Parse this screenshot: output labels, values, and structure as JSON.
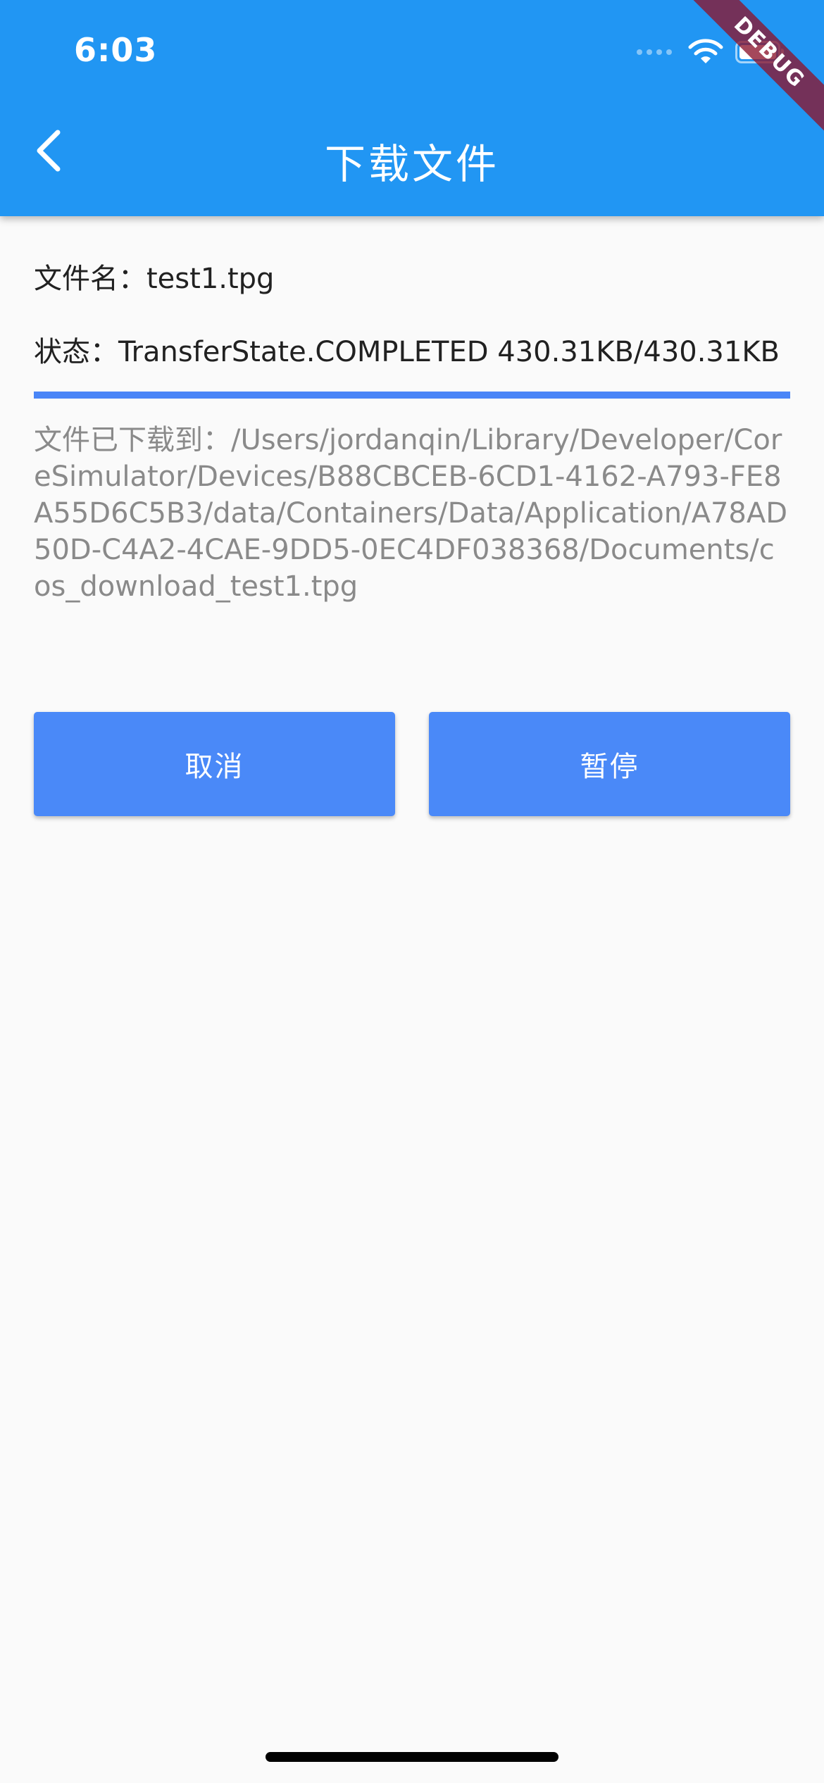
{
  "status_bar": {
    "time": "6:03"
  },
  "app_bar": {
    "title": "下载文件",
    "back_icon": "chevron-left-icon",
    "color": "#2196F3"
  },
  "debug_banner": {
    "label": "DEBUG"
  },
  "content": {
    "file_name_text": "文件名：test1.tpg",
    "status_text": "状态：TransferState.COMPLETED  430.31KB/430.31KB",
    "progress_fraction": 1.0,
    "saved_path_text": "文件已下载到：/Users/jordanqin/Library/Developer/CoreSimulator/Devices/B88CBCEB-6CD1-4162-A793-FE8A55D6C5B3/data/Containers/Data/Application/A78AD50D-C4A2-4CAE-9DD5-0EC4DF038368/Documents/cos_download_test1.tpg"
  },
  "buttons": {
    "cancel_label": "取消",
    "pause_label": "暂停",
    "color": "#4A89F8"
  }
}
